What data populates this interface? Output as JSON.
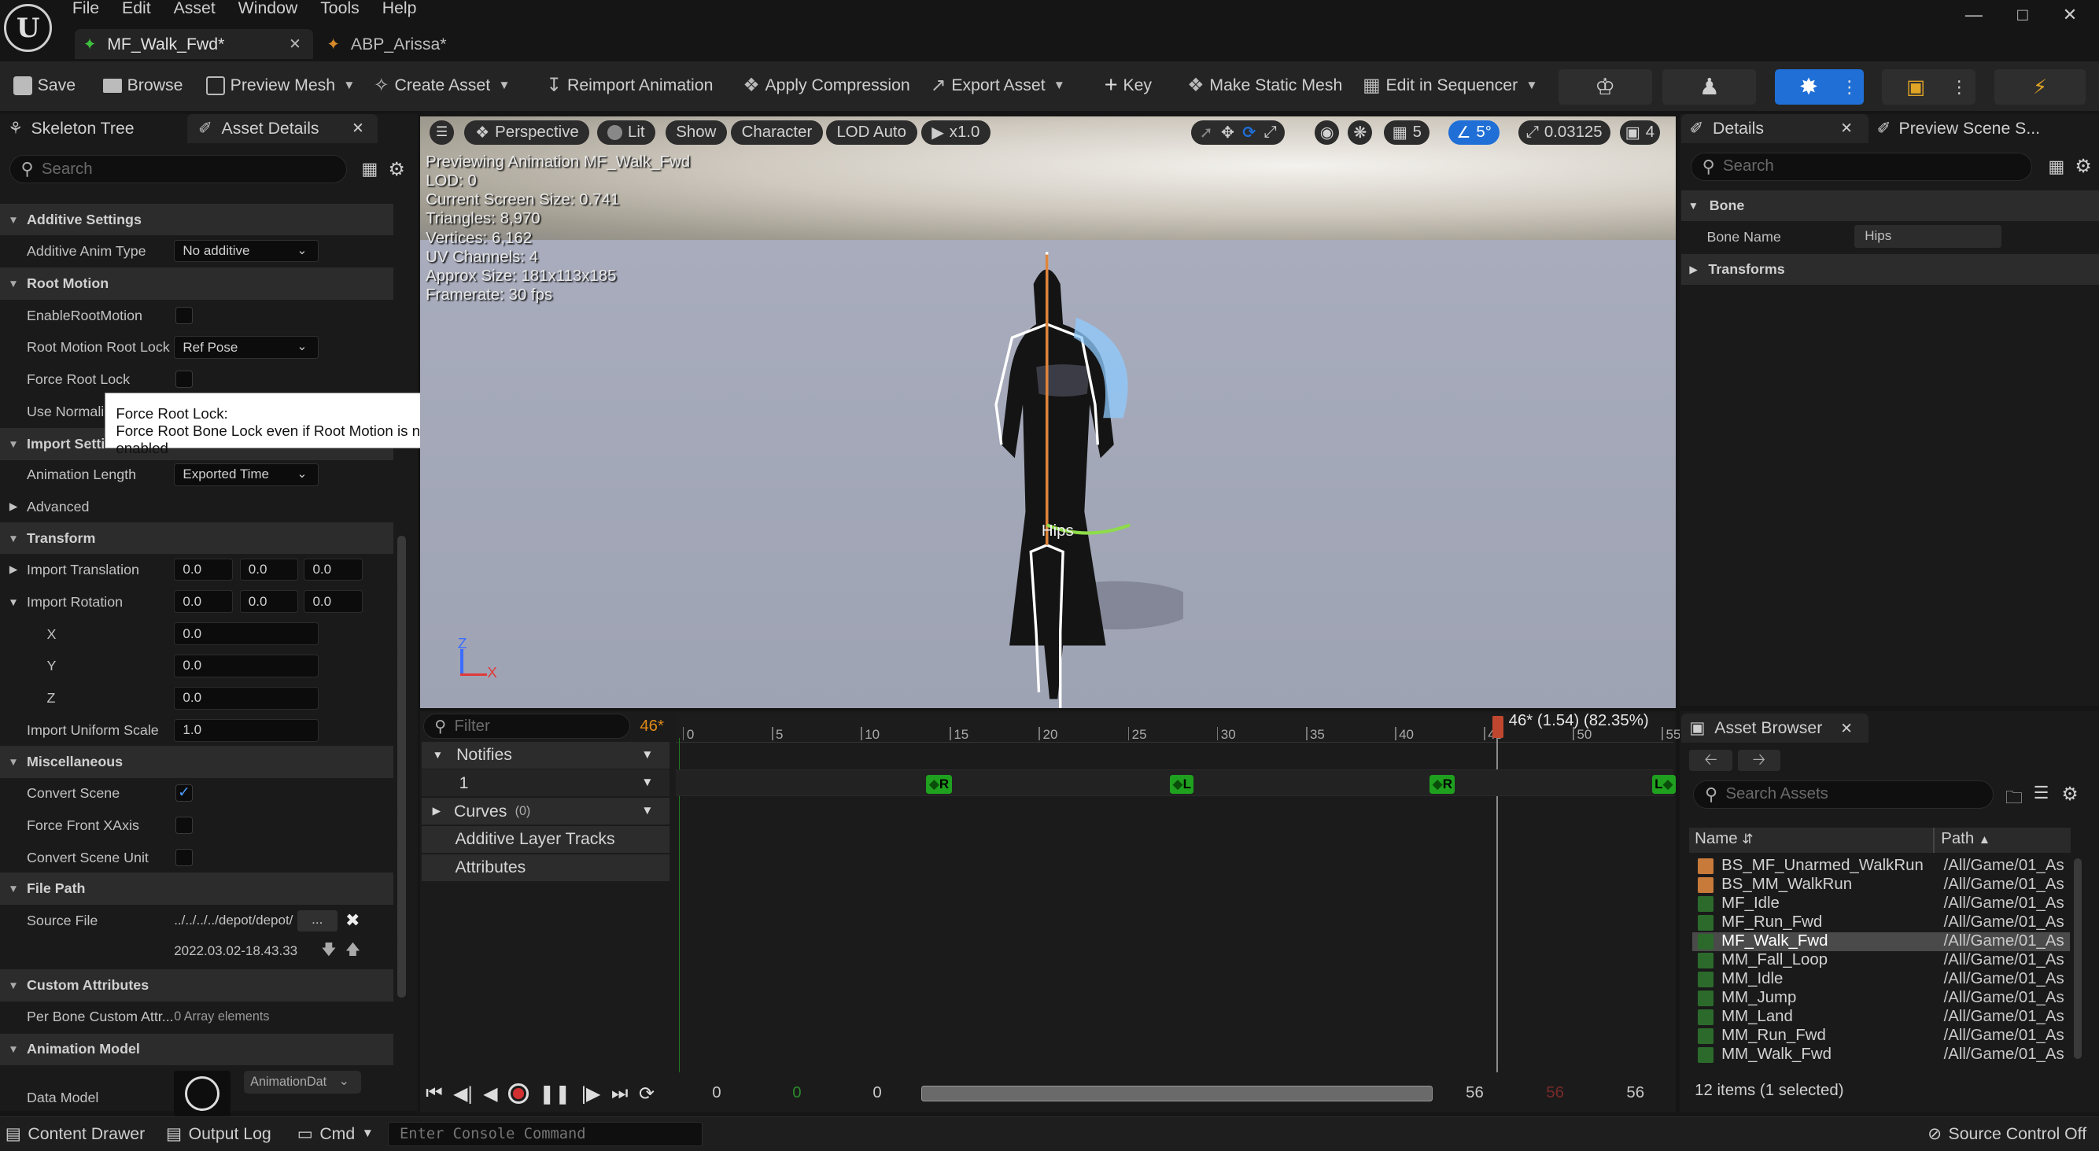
{
  "menu": [
    "File",
    "Edit",
    "Asset",
    "Window",
    "Tools",
    "Help"
  ],
  "doc_tabs": [
    {
      "label": "MF_Walk_Fwd*"
    },
    {
      "label": "ABP_Arissa*"
    }
  ],
  "toolbar": {
    "save": "Save",
    "browse": "Browse",
    "preview_mesh": "Preview Mesh",
    "create_asset": "Create Asset",
    "reimport": "Reimport Animation",
    "apply_compression": "Apply Compression",
    "export_asset": "Export Asset",
    "key": "Key",
    "make_static_mesh": "Make Static Mesh",
    "edit_in_sequencer": "Edit in Sequencer"
  },
  "left_tabs": {
    "skeleton_tree": "Skeleton Tree",
    "asset_details": "Asset Details"
  },
  "left_search": "Search",
  "props": {
    "additive_settings": "Additive Settings",
    "additive_anim_type": "Additive Anim Type",
    "additive_anim_type_val": "No additive",
    "root_motion": "Root Motion",
    "enable_root_motion": "EnableRootMotion",
    "root_motion_root_lock": "Root Motion Root Lock",
    "root_motion_root_lock_val": "Ref Pose",
    "force_root_lock": "Force Root Lock",
    "use_normalized": "Use Normaliz",
    "import_settings": "Import Settin",
    "animation_length": "Animation Length",
    "animation_length_val": "Exported Time",
    "advanced": "Advanced",
    "transform": "Transform",
    "import_translation": "Import Translation",
    "it": [
      "0.0",
      "0.0",
      "0.0"
    ],
    "import_rotation": "Import Rotation",
    "ir": [
      "0.0",
      "0.0",
      "0.0"
    ],
    "x": "X",
    "x_val": "0.0",
    "y": "Y",
    "y_val": "0.0",
    "z": "Z",
    "z_val": "0.0",
    "import_uniform_scale": "Import Uniform Scale",
    "import_uniform_scale_val": "1.0",
    "misc": "Miscellaneous",
    "convert_scene": "Convert Scene",
    "force_front_xaxis": "Force Front XAxis",
    "convert_scene_unit": "Convert Scene Unit",
    "file_path": "File Path",
    "source_file": "Source File",
    "source_file_val": "../../../../depot/depot/",
    "browse_dots": "...",
    "timestamp": "2022.03.02-18.43.33",
    "custom_attributes": "Custom Attributes",
    "per_bone": "Per Bone Custom Attr...",
    "per_bone_val": "0 Array elements",
    "animation_model": "Animation Model",
    "data_model": "Data Model",
    "data_model_val": "AnimationDat"
  },
  "tooltip": {
    "title": "Force Root Lock:",
    "body": "Force Root Bone Lock even if Root Motion is not enabled"
  },
  "viewport": {
    "perspective": "Perspective",
    "lit": "Lit",
    "show": "Show",
    "character": "Character",
    "lod": "LOD Auto",
    "speed": "x1.0",
    "grid": "5",
    "angle": "5°",
    "scale": "0.03125",
    "cam": "4",
    "overlay": [
      "Previewing Animation MF_Walk_Fwd",
      "LOD: 0",
      "Current Screen Size: 0.741",
      "Triangles: 8,970",
      "Vertices: 6,162",
      "UV Channels: 4",
      "Approx Size: 181x113x185",
      "Framerate: 30 fps"
    ],
    "bone_label": "Hips",
    "axis_z": "Z",
    "axis_x": "X"
  },
  "timeline": {
    "filter": "Filter",
    "frame": "46*",
    "scrub_label": "46* (1.54) (82.35%)",
    "ticks": [
      "0",
      "5",
      "10",
      "15",
      "20",
      "25",
      "30",
      "35",
      "40",
      "45",
      "50",
      "55"
    ],
    "notifies": "Notifies",
    "track1": "1",
    "curves": "Curves",
    "curves_count": "(0)",
    "additive_layer": "Additive Layer Tracks",
    "attributes": "Attributes",
    "keys": [
      "R",
      "L",
      "R",
      "L"
    ],
    "bottom": [
      "0",
      "0",
      "0",
      "56",
      "56",
      "56"
    ]
  },
  "details": {
    "tab": "Details",
    "tab2": "Preview Scene S...",
    "search": "Search",
    "bone": "Bone",
    "bone_name": "Bone Name",
    "bone_name_val": "Hips",
    "transforms": "Transforms"
  },
  "asset_browser": {
    "tab": "Asset Browser",
    "search": "Search Assets",
    "col_name": "Name",
    "col_path": "Path",
    "items": [
      {
        "name": "BS_MF_Unarmed_WalkRun",
        "path": "/All/Game/01_As",
        "kind": "bs"
      },
      {
        "name": "BS_MM_WalkRun",
        "path": "/All/Game/01_As",
        "kind": "bs"
      },
      {
        "name": "MF_Idle",
        "path": "/All/Game/01_As",
        "kind": "anim"
      },
      {
        "name": "MF_Run_Fwd",
        "path": "/All/Game/01_As",
        "kind": "anim"
      },
      {
        "name": "MF_Walk_Fwd",
        "path": "/All/Game/01_As",
        "kind": "anim"
      },
      {
        "name": "MM_Fall_Loop",
        "path": "/All/Game/01_As",
        "kind": "anim"
      },
      {
        "name": "MM_Idle",
        "path": "/All/Game/01_As",
        "kind": "anim"
      },
      {
        "name": "MM_Jump",
        "path": "/All/Game/01_As",
        "kind": "anim"
      },
      {
        "name": "MM_Land",
        "path": "/All/Game/01_As",
        "kind": "anim"
      },
      {
        "name": "MM_Run_Fwd",
        "path": "/All/Game/01_As",
        "kind": "anim"
      },
      {
        "name": "MM_Walk_Fwd",
        "path": "/All/Game/01_As",
        "kind": "anim"
      }
    ],
    "status": "12 items (1 selected)"
  },
  "statusbar": {
    "content_drawer": "Content Drawer",
    "output_log": "Output Log",
    "cmd": "Cmd",
    "console_placeholder": "Enter Console Command",
    "source_control": "Source Control Off"
  },
  "colors": {
    "accent": "#1f6fd6",
    "key_green": "#1fa11f",
    "scrub": "#c0472f",
    "frame_orange": "#e08a18"
  }
}
